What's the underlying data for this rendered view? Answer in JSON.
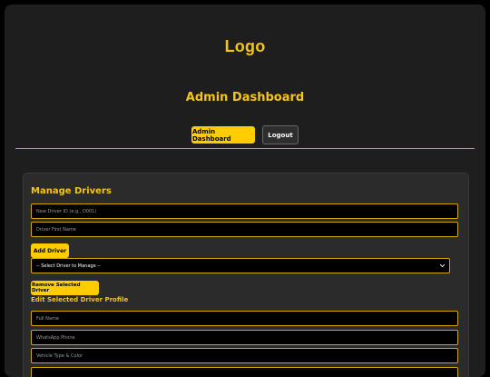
{
  "header": {
    "logo_text": "Logo",
    "dashboard_title": "Admin Dashboard"
  },
  "nav": {
    "admin_dashboard_label": "Admin Dashboard",
    "logout_label": "Logout"
  },
  "manage_drivers": {
    "title": "Manage Drivers",
    "new_driver_id_placeholder": "New Driver ID (e.g., D001)",
    "driver_first_name_placeholder": "Driver First Name",
    "add_driver_label": "Add Driver",
    "select_driver_value": "-- Select Driver to Manage --",
    "remove_driver_label": "Remove Selected Driver"
  },
  "edit_profile": {
    "title": "Edit Selected Driver Profile",
    "full_name_placeholder": "Full Name",
    "whatsapp_phone_placeholder": "WhatsApp Phone",
    "vehicle_type_placeholder": "Vehicle Type & Color"
  },
  "colors": {
    "accent": "#f5c518",
    "button_yellow": "#ffcc00",
    "background": "#1e1e1e",
    "card": "#2b2b2b"
  }
}
